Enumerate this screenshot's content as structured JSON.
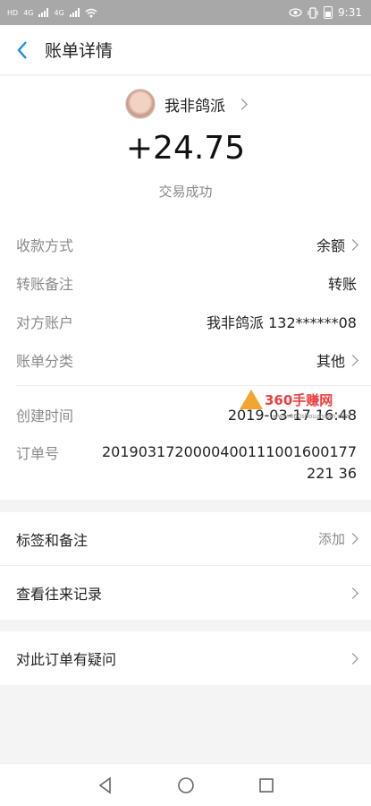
{
  "status_bar": {
    "network_left": "HD",
    "carrier_tag_1": "4G",
    "carrier_tag_2": "4G",
    "time": "9:31",
    "icons": [
      "signal-icon",
      "wifi-icon",
      "eye-icon",
      "vibrate-icon",
      "battery-icon"
    ]
  },
  "header": {
    "title": "账单详情",
    "back_icon": "chevron-left-icon"
  },
  "bill": {
    "payer_name": "我非鸽派",
    "amount": "+24.75",
    "status": "交易成功",
    "rows": [
      {
        "label": "收款方式",
        "value": "余额",
        "has_chevron": true
      },
      {
        "label": "转账备注",
        "value": "转账",
        "has_chevron": false
      },
      {
        "label": "对方账户",
        "value": "我非鸽派 132******08",
        "has_chevron": false
      },
      {
        "label": "账单分类",
        "value": "其他",
        "has_chevron": true
      },
      {
        "label": "创建时间",
        "value": "2019-03-17 16:48",
        "has_chevron": false
      }
    ],
    "order": {
      "label": "订单号",
      "value": "2019031720000400111001600177221 36"
    }
  },
  "watermark": {
    "text": "360手赚网",
    "sub": "www.360shouzhuan.com"
  },
  "actions": [
    {
      "label": "标签和备注",
      "right": "添加"
    },
    {
      "label": "查看往来记录",
      "right": ""
    }
  ],
  "dispute": {
    "label": "对此订单有疑问"
  },
  "colors": {
    "accent": "#1a8fe3",
    "status_bar": "#a8a8a8",
    "background": "#f4f4f4"
  }
}
